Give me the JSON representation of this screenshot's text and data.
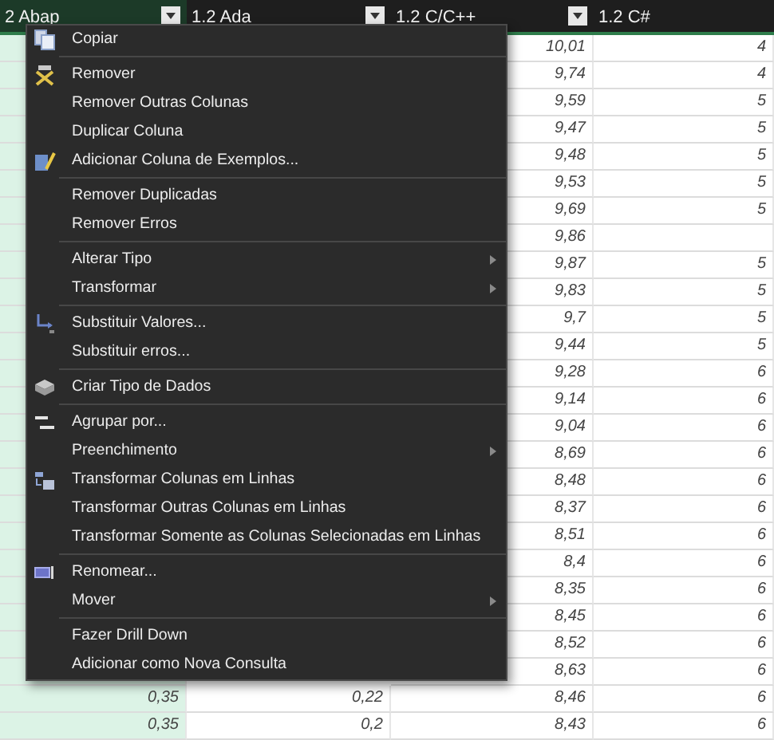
{
  "table": {
    "columns": [
      {
        "label": "2 Abap",
        "selected": true,
        "filter_button": true
      },
      {
        "label": "1.2 Ada",
        "selected": false,
        "filter_button": true
      },
      {
        "label": "1.2 C/C++",
        "selected": false,
        "filter_button": true
      },
      {
        "label": "1.2 C#",
        "selected": false,
        "filter_button": false
      }
    ],
    "rows": [
      {
        "c_cpp": "10,01",
        "c_sharp": "4"
      },
      {
        "c_cpp": "9,74",
        "c_sharp": "4"
      },
      {
        "c_cpp": "9,59",
        "c_sharp": "5"
      },
      {
        "c_cpp": "9,47",
        "c_sharp": "5"
      },
      {
        "c_cpp": "9,48",
        "c_sharp": "5"
      },
      {
        "c_cpp": "9,53",
        "c_sharp": "5"
      },
      {
        "c_cpp": "9,69",
        "c_sharp": "5"
      },
      {
        "c_cpp": "9,86"
      },
      {
        "c_cpp": "9,87",
        "c_sharp": "5"
      },
      {
        "c_cpp": "9,83",
        "c_sharp": "5"
      },
      {
        "c_cpp": "9,7",
        "c_sharp": "5"
      },
      {
        "c_cpp": "9,44",
        "c_sharp": "5"
      },
      {
        "c_cpp": "9,28",
        "c_sharp": "6"
      },
      {
        "c_cpp": "9,14",
        "c_sharp": "6"
      },
      {
        "c_cpp": "9,04",
        "c_sharp": "6"
      },
      {
        "c_cpp": "8,69",
        "c_sharp": "6"
      },
      {
        "c_cpp": "8,48",
        "c_sharp": "6"
      },
      {
        "c_cpp": "8,37",
        "c_sharp": "6"
      },
      {
        "c_cpp": "8,51",
        "c_sharp": "6"
      },
      {
        "c_cpp": "8,4",
        "c_sharp": "6"
      },
      {
        "c_cpp": "8,35",
        "c_sharp": "6"
      },
      {
        "c_cpp": "8,45",
        "c_sharp": "6"
      },
      {
        "c_cpp": "8,52",
        "c_sharp": "6"
      },
      {
        "c_cpp": "8,63",
        "c_sharp": "6"
      },
      {
        "abap": "0,35",
        "ada": "0,22",
        "c_cpp": "8,46",
        "c_sharp": "6"
      },
      {
        "abap": "0,35",
        "ada": "0,2",
        "c_cpp": "8,43",
        "c_sharp": "6"
      }
    ]
  },
  "context_menu": {
    "groups": [
      [
        {
          "label": "Copiar",
          "kind": "copy",
          "submenu": false
        }
      ],
      [
        {
          "label": "Remover",
          "kind": "remove",
          "submenu": false
        },
        {
          "label": "Remover Outras Colunas",
          "submenu": false
        },
        {
          "label": "Duplicar Coluna",
          "submenu": false
        },
        {
          "label": "Adicionar Coluna de Exemplos...",
          "kind": "examples",
          "submenu": false
        }
      ],
      [
        {
          "label": "Remover Duplicadas",
          "submenu": false
        },
        {
          "label": "Remover Erros",
          "submenu": false
        }
      ],
      [
        {
          "label": "Alterar Tipo",
          "submenu": true
        },
        {
          "label": "Transformar",
          "submenu": true
        }
      ],
      [
        {
          "label": "Substituir Valores...",
          "kind": "replace",
          "submenu": false
        },
        {
          "label": "Substituir erros...",
          "submenu": false
        }
      ],
      [
        {
          "label": "Criar Tipo de Dados",
          "kind": "datatype",
          "submenu": false
        }
      ],
      [
        {
          "label": "Agrupar por...",
          "kind": "group",
          "submenu": false
        },
        {
          "label": "Preenchimento",
          "submenu": true
        },
        {
          "label": "Transformar Colunas em Linhas",
          "kind": "unpivot",
          "submenu": false
        },
        {
          "label": "Transformar Outras Colunas em Linhas",
          "submenu": false
        },
        {
          "label": "Transformar Somente as Colunas Selecionadas em Linhas",
          "submenu": false
        }
      ],
      [
        {
          "label": "Renomear...",
          "kind": "rename",
          "submenu": false
        },
        {
          "label": "Mover",
          "submenu": true
        }
      ],
      [
        {
          "label": "Fazer Drill Down",
          "submenu": false
        },
        {
          "label": "Adicionar como Nova Consulta",
          "submenu": false
        }
      ]
    ]
  }
}
